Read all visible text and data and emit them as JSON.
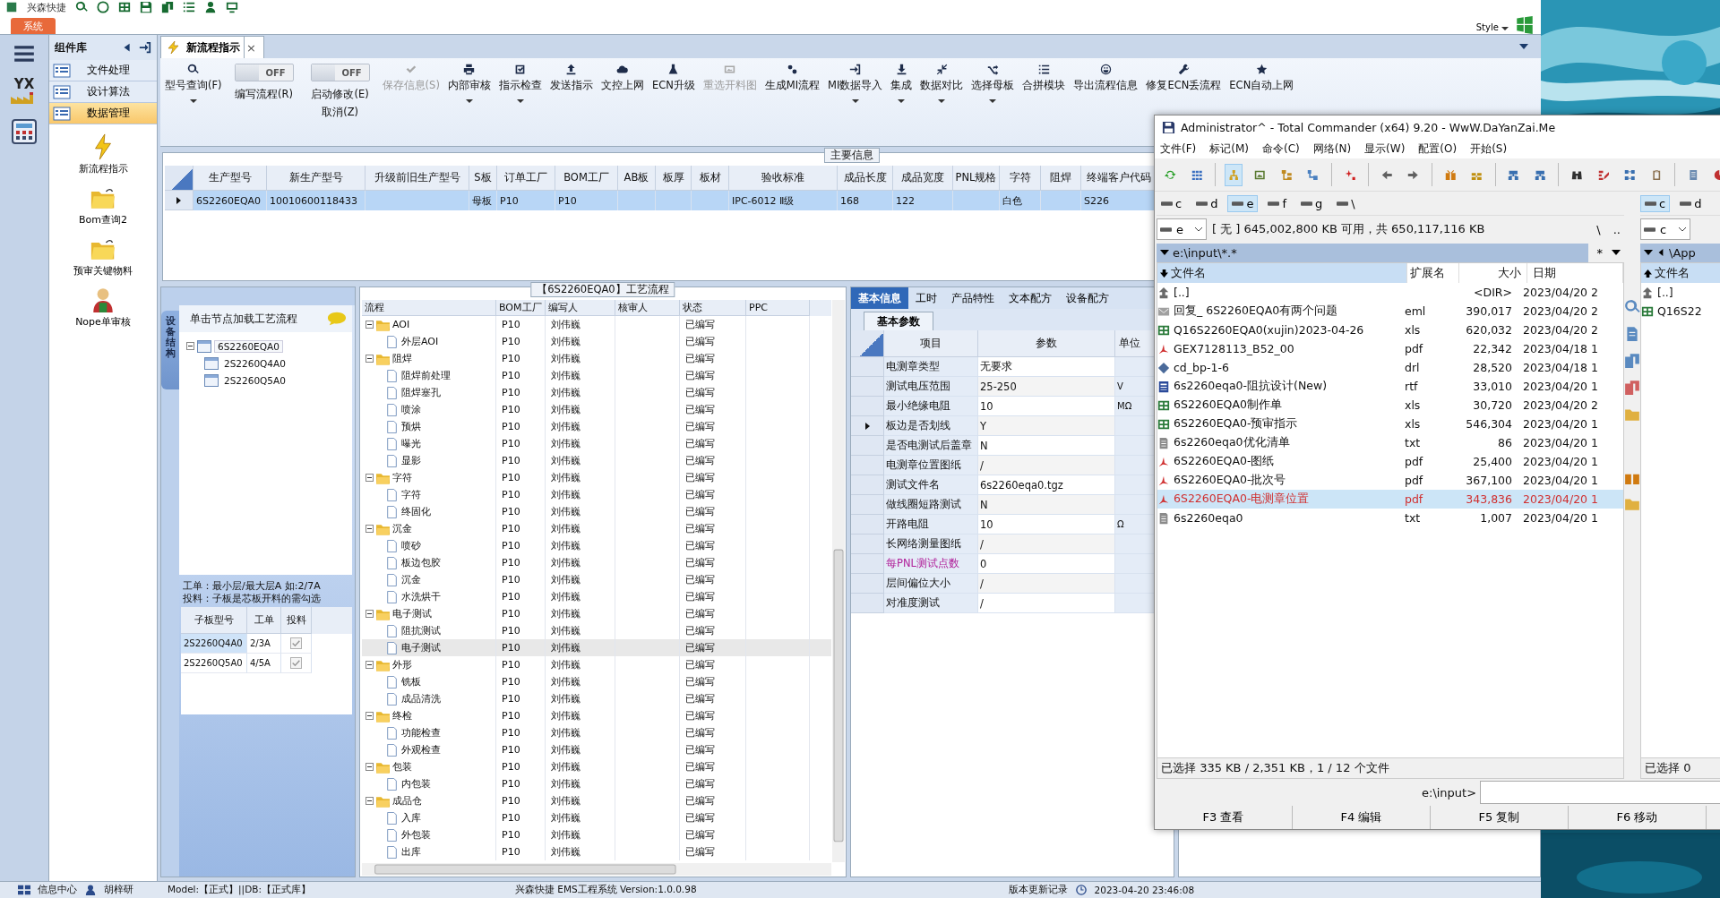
{
  "top_bar": {
    "app_name": "兴森快捷",
    "system_tab": "系统",
    "style_menu": "Style"
  },
  "nav": {
    "logo_text": "YX"
  },
  "component_library": {
    "title": "组件库",
    "items": [
      {
        "label": "文件处理",
        "selected": false
      },
      {
        "label": "设计算法",
        "selected": false
      },
      {
        "label": "数据管理",
        "selected": true
      }
    ],
    "launchers": [
      {
        "label": "新流程指示"
      },
      {
        "label": "Bom查询2"
      },
      {
        "label": "预审关键物料"
      },
      {
        "label": "Nope单审核"
      }
    ]
  },
  "document_tab": {
    "label": "新流程指示",
    "close": "×"
  },
  "toolbar": [
    {
      "kind": "button",
      "label": "型号查询(F)",
      "dropdown": true,
      "disabled": false
    },
    {
      "kind": "toggle",
      "label": "编写流程(R)",
      "switch_text": "OFF",
      "on": false
    },
    {
      "kind": "toggle",
      "label": "启动修改(E)\n取消(Z)",
      "switch_text": "OFF",
      "on": false
    },
    {
      "kind": "button",
      "label": "保存信息(S)",
      "dropdown": false,
      "disabled": true
    },
    {
      "kind": "button",
      "label": "内部审核",
      "dropdown": true,
      "disabled": false
    },
    {
      "kind": "button",
      "label": "指示检查",
      "dropdown": true,
      "disabled": false
    },
    {
      "kind": "button",
      "label": "发送指示",
      "dropdown": false,
      "disabled": false
    },
    {
      "kind": "button",
      "label": "文控上网",
      "dropdown": false,
      "disabled": false
    },
    {
      "kind": "button",
      "label": "ECN升级",
      "dropdown": false,
      "disabled": false
    },
    {
      "kind": "button",
      "label": "重选开料图",
      "dropdown": false,
      "disabled": true
    },
    {
      "kind": "button",
      "label": "生成MI流程",
      "dropdown": false,
      "disabled": false
    },
    {
      "kind": "button",
      "label": "MI数据导入",
      "dropdown": true,
      "disabled": false
    },
    {
      "kind": "button",
      "label": "集成",
      "dropdown": true,
      "disabled": false
    },
    {
      "kind": "button",
      "label": "数据对比",
      "dropdown": true,
      "disabled": false
    },
    {
      "kind": "button",
      "label": "选择母板",
      "dropdown": true,
      "disabled": false
    },
    {
      "kind": "button",
      "label": "合拼模块",
      "dropdown": false,
      "disabled": false
    },
    {
      "kind": "button",
      "label": "导出流程信息",
      "dropdown": false,
      "disabled": false
    },
    {
      "kind": "button",
      "label": "修复ECN丢流程",
      "dropdown": false,
      "disabled": false
    },
    {
      "kind": "button",
      "label": "ECN自动上网",
      "dropdown": false,
      "disabled": false
    }
  ],
  "main_info": {
    "title": "主要信息",
    "columns": [
      "生产型号",
      "新生产型号",
      "升级前旧生产型号",
      "S板",
      "订单工厂",
      "BOM工厂",
      "AB板",
      "板厚",
      "板材",
      "验收标准",
      "成品长度",
      "成品宽度",
      "PNL规格",
      "字符",
      "阻焊",
      "终端客户代码"
    ],
    "rows": [
      {
        "selected": true,
        "cells": [
          "6S2260EQA0",
          "10010600118433",
          "",
          "母板",
          "P10",
          "P10",
          "",
          "",
          "",
          "IPC-6012 Ⅱ级",
          "168",
          "122",
          "",
          "白色",
          "",
          "S226"
        ]
      }
    ]
  },
  "structure": {
    "side_tab": "设备结构",
    "hint": "单击节点加载工艺流程",
    "tree": [
      {
        "label": "6S2260EQA0",
        "expanded": true,
        "selected": true,
        "children": [
          {
            "label": "2S2260Q4A0",
            "selected": false
          },
          {
            "label": "2S2260Q5A0",
            "selected": false
          }
        ]
      }
    ],
    "notes": [
      "工单：最小层/最大层A 如:2/7A",
      "投料：子板是芯板开料的需勾选"
    ],
    "sub_boards": {
      "columns": [
        "子板型号",
        "工单",
        "投料"
      ],
      "rows": [
        {
          "board": "2S2260Q4A0",
          "order": "2/3A",
          "feed": true,
          "selected": true
        },
        {
          "board": "2S2260Q5A0",
          "order": "4/5A",
          "feed": true,
          "selected": false
        }
      ]
    }
  },
  "process": {
    "title": "【6S2260EQA0】工艺流程",
    "columns": [
      "流程",
      "BOM工厂",
      "编写人",
      "核审人",
      "状态",
      "PPC"
    ],
    "rows": [
      {
        "name": "AOI",
        "bom": "P10",
        "writer": "刘伟巍",
        "status": "已编写",
        "expanded": true,
        "selected": false,
        "children": [
          {
            "name": "外层AOI",
            "bom": "P10",
            "writer": "刘伟巍",
            "status": "已编写",
            "selected": false
          }
        ]
      },
      {
        "name": "阻焊",
        "bom": "P10",
        "writer": "刘伟巍",
        "status": "已编写",
        "expanded": true,
        "selected": false,
        "children": [
          {
            "name": "阻焊前处理",
            "bom": "P10",
            "writer": "刘伟巍",
            "status": "已编写",
            "selected": false
          },
          {
            "name": "阻焊塞孔",
            "bom": "P10",
            "writer": "刘伟巍",
            "status": "已编写",
            "selected": false
          },
          {
            "name": "喷涂",
            "bom": "P10",
            "writer": "刘伟巍",
            "status": "已编写",
            "selected": false
          },
          {
            "name": "预烘",
            "bom": "P10",
            "writer": "刘伟巍",
            "status": "已编写",
            "selected": false
          },
          {
            "name": "曝光",
            "bom": "P10",
            "writer": "刘伟巍",
            "status": "已编写",
            "selected": false
          },
          {
            "name": "显影",
            "bom": "P10",
            "writer": "刘伟巍",
            "status": "已编写",
            "selected": false
          }
        ]
      },
      {
        "name": "字符",
        "bom": "P10",
        "writer": "刘伟巍",
        "status": "已编写",
        "expanded": true,
        "selected": false,
        "children": [
          {
            "name": "字符",
            "bom": "P10",
            "writer": "刘伟巍",
            "status": "已编写",
            "selected": false
          },
          {
            "name": "终固化",
            "bom": "P10",
            "writer": "刘伟巍",
            "status": "已编写",
            "selected": false
          }
        ]
      },
      {
        "name": "沉金",
        "bom": "P10",
        "writer": "刘伟巍",
        "status": "已编写",
        "expanded": true,
        "selected": false,
        "children": [
          {
            "name": "喷砂",
            "bom": "P10",
            "writer": "刘伟巍",
            "status": "已编写",
            "selected": false
          },
          {
            "name": "板边包胶",
            "bom": "P10",
            "writer": "刘伟巍",
            "status": "已编写",
            "selected": false
          },
          {
            "name": "沉金",
            "bom": "P10",
            "writer": "刘伟巍",
            "status": "已编写",
            "selected": false
          },
          {
            "name": "水洗烘干",
            "bom": "P10",
            "writer": "刘伟巍",
            "status": "已编写",
            "selected": false
          }
        ]
      },
      {
        "name": "电子测试",
        "bom": "P10",
        "writer": "刘伟巍",
        "status": "已编写",
        "expanded": true,
        "selected": false,
        "children": [
          {
            "name": "阻抗测试",
            "bom": "P10",
            "writer": "刘伟巍",
            "status": "已编写",
            "selected": false
          },
          {
            "name": "电子测试",
            "bom": "P10",
            "writer": "刘伟巍",
            "status": "已编写",
            "selected": true
          }
        ]
      },
      {
        "name": "外形",
        "bom": "P10",
        "writer": "刘伟巍",
        "status": "已编写",
        "expanded": true,
        "selected": false,
        "children": [
          {
            "name": "铣板",
            "bom": "P10",
            "writer": "刘伟巍",
            "status": "已编写",
            "selected": false
          },
          {
            "name": "成品清洗",
            "bom": "P10",
            "writer": "刘伟巍",
            "status": "已编写",
            "selected": false
          }
        ]
      },
      {
        "name": "终检",
        "bom": "P10",
        "writer": "刘伟巍",
        "status": "已编写",
        "expanded": true,
        "selected": false,
        "children": [
          {
            "name": "功能检查",
            "bom": "P10",
            "writer": "刘伟巍",
            "status": "已编写",
            "selected": false
          },
          {
            "name": "外观检查",
            "bom": "P10",
            "writer": "刘伟巍",
            "status": "已编写",
            "selected": false
          }
        ]
      },
      {
        "name": "包装",
        "bom": "P10",
        "writer": "刘伟巍",
        "status": "已编写",
        "expanded": true,
        "selected": false,
        "children": [
          {
            "name": "内包装",
            "bom": "P10",
            "writer": "刘伟巍",
            "status": "已编写",
            "selected": false
          }
        ]
      },
      {
        "name": "成品仓",
        "bom": "P10",
        "writer": "刘伟巍",
        "status": "已编写",
        "expanded": true,
        "selected": false,
        "children": [
          {
            "name": "入库",
            "bom": "P10",
            "writer": "刘伟巍",
            "status": "已编写",
            "selected": false
          },
          {
            "name": "外包装",
            "bom": "P10",
            "writer": "刘伟巍",
            "status": "已编写",
            "selected": false
          },
          {
            "name": "出库",
            "bom": "P10",
            "writer": "刘伟巍",
            "status": "已编写",
            "selected": false
          }
        ]
      }
    ]
  },
  "params": {
    "tabs": [
      {
        "label": "基本信息",
        "selected": true
      },
      {
        "label": "工时",
        "selected": false
      },
      {
        "label": "产品特性",
        "selected": false
      },
      {
        "label": "文本配方",
        "selected": false
      },
      {
        "label": "设备配方",
        "selected": false
      }
    ],
    "subtab": "基本参数",
    "columns": [
      "项目",
      "参数",
      "单位"
    ],
    "rows": [
      {
        "item": "电测章类型",
        "value": "无要求",
        "selected": false,
        "highlighted": false
      },
      {
        "item": "测试电压范围",
        "value": "25-250",
        "unit": "V",
        "selected": false,
        "highlighted": false
      },
      {
        "item": "最小绝缘电阻",
        "value": "10",
        "unit": "MΩ",
        "selected": false,
        "highlighted": false
      },
      {
        "item": "板边是否划线",
        "value": "Y",
        "selected": true,
        "highlighted": false
      },
      {
        "item": "是否电测试后盖章",
        "value": "N",
        "selected": false,
        "highlighted": false
      },
      {
        "item": "电测章位置图纸",
        "value": "/",
        "selected": false,
        "highlighted": false
      },
      {
        "item": "测试文件名",
        "value": "6s2260eqa0.tgz",
        "selected": false,
        "highlighted": false
      },
      {
        "item": "做线圈短路测试",
        "value": "N",
        "selected": false,
        "highlighted": false
      },
      {
        "item": "开路电阻",
        "value": "10",
        "unit": "Ω",
        "selected": false,
        "highlighted": false
      },
      {
        "item": "长网络测量图纸",
        "value": "/",
        "selected": false,
        "highlighted": false
      },
      {
        "item": "每PNL测试点数",
        "value": "0",
        "selected": false,
        "highlighted": true
      },
      {
        "item": "层间偏位大小",
        "value": "/",
        "selected": false,
        "highlighted": false
      },
      {
        "item": "对准度测试",
        "value": "/",
        "selected": false,
        "highlighted": false
      }
    ]
  },
  "status_bar": {
    "info_center": "信息中心",
    "user": "胡梓研",
    "env": "Model:【正式】||DB:【正式库】",
    "version": "兴森快捷 EMS工程系统 Version:1.0.0.98",
    "changelog": "版本更新记录",
    "time": "2023-04-20 23:46:08"
  },
  "total_commander": {
    "title": "Administrator^ - Total Commander (x64) 9.20 - WwW.DaYanZai.Me",
    "menu": [
      "文件(F)",
      "标记(M)",
      "命令(C)",
      "网络(N)",
      "显示(W)",
      "配置(O)",
      "开始(S)"
    ],
    "left": {
      "drives": [
        {
          "label": "c",
          "selected": false
        },
        {
          "label": "d",
          "selected": false
        },
        {
          "label": "e",
          "selected": true
        },
        {
          "label": "f",
          "selected": false
        },
        {
          "label": "g",
          "selected": false
        },
        {
          "label": "\\",
          "selected": false
        }
      ],
      "drive_combo": "e",
      "free_space": "[ 无 ]  645,002,800 KB 可用，共 650,117,116 KB",
      "root_button": "\\",
      "up_button": "..",
      "path": "e:\\input\\*.*",
      "filter_button": "*",
      "columns": [
        "文件名",
        "扩展名",
        "大小",
        "日期"
      ],
      "files": [
        {
          "name": "[..]",
          "size": "<DIR>",
          "date": "2023/04/20 2",
          "selected": false
        },
        {
          "name": "回复_ 6S2260EQA0有两个问题",
          "ext": "eml",
          "size": "390,017",
          "date": "2023/04/20 2",
          "selected": false
        },
        {
          "name": "Q16S2260EQA0(xujin)2023-04-26",
          "ext": "xls",
          "size": "620,032",
          "date": "2023/04/20 2",
          "selected": false
        },
        {
          "name": "GEX7128113_B52_00",
          "ext": "pdf",
          "size": "22,342",
          "date": "2023/04/18 1",
          "selected": false
        },
        {
          "name": "cd_bp-1-6",
          "ext": "drl",
          "size": "28,520",
          "date": "2023/04/18 1",
          "selected": false
        },
        {
          "name": "6s2260eqa0-阻抗设计(New)",
          "ext": "rtf",
          "size": "33,010",
          "date": "2023/04/20 1",
          "selected": false
        },
        {
          "name": "6S2260EQA0制作单",
          "ext": "xls",
          "size": "30,720",
          "date": "2023/04/20 2",
          "selected": false
        },
        {
          "name": "6S2260EQA0-预审指示",
          "ext": "xls",
          "size": "546,304",
          "date": "2023/04/20 1",
          "selected": false
        },
        {
          "name": "6s2260eqa0优化清单",
          "ext": "txt",
          "size": "86",
          "date": "2023/04/20 1",
          "selected": false
        },
        {
          "name": "6S2260EQA0-图纸",
          "ext": "pdf",
          "size": "25,400",
          "date": "2023/04/20 1",
          "selected": false
        },
        {
          "name": "6S2260EQA0-批次号",
          "ext": "pdf",
          "size": "367,100",
          "date": "2023/04/20 1",
          "selected": false
        },
        {
          "name": "6S2260EQA0-电测章位置",
          "ext": "pdf",
          "size": "343,836",
          "date": "2023/04/20 1",
          "selected": true
        },
        {
          "name": "6s2260eqa0",
          "ext": "txt",
          "size": "1,007",
          "date": "2023/04/20 1",
          "selected": false
        }
      ],
      "status": "已选择 335 KB / 2,351 KB，1 / 12 个文件"
    },
    "right": {
      "drives": [
        {
          "label": "c",
          "selected": true
        },
        {
          "label": "d",
          "selected": false
        }
      ],
      "drive_combo": "c",
      "path": "\\App",
      "columns": [
        "文件名"
      ],
      "files": [
        {
          "name": "[..]",
          "kind": "parent"
        },
        {
          "name": "Q16S22",
          "kind": "spreadsheet"
        }
      ],
      "status": "已选择 0"
    },
    "command_prompt": "e:\\input>",
    "function_keys": [
      "F3 查看",
      "F4 编辑",
      "F5 复制",
      "F6 移动"
    ]
  }
}
